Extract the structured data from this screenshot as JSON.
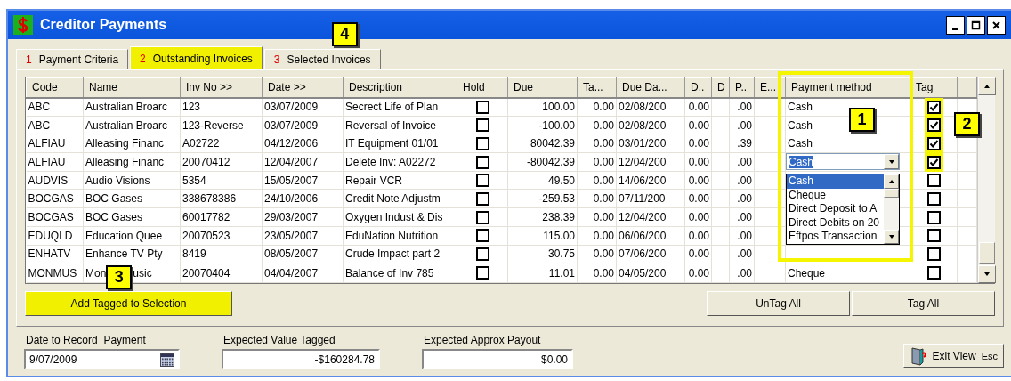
{
  "window": {
    "title": "Creditor Payments"
  },
  "tabs": [
    {
      "number": "1",
      "label": "Payment Criteria",
      "selected": false,
      "highlighted": false
    },
    {
      "number": "2",
      "label": "Outstanding Invoices",
      "selected": true,
      "highlighted": true
    },
    {
      "number": "3",
      "label": "Selected Invoices",
      "selected": false,
      "highlighted": false,
      "callout": "4"
    }
  ],
  "table": {
    "columns": [
      {
        "label": "Code"
      },
      {
        "label": "Name"
      },
      {
        "label": "Inv No >>"
      },
      {
        "label": "Date >>"
      },
      {
        "label": "Description"
      },
      {
        "label": "Hold"
      },
      {
        "label": "Due"
      },
      {
        "label": "Ta..."
      },
      {
        "label": "Due Da..."
      },
      {
        "label": "D.."
      },
      {
        "label": "D"
      },
      {
        "label": "P.."
      },
      {
        "label": "E..."
      },
      {
        "label": "Payment method",
        "highlighted": true,
        "callout": "1"
      },
      {
        "label": "Tag",
        "callout": "2"
      }
    ],
    "rows": [
      {
        "code": "ABC",
        "name": "Australian Broarc",
        "inv_no": "123",
        "date": "03/07/2009",
        "description": "Secrect Life of Plan",
        "hold": false,
        "due": "100.00",
        "ta": "0.00",
        "due_date": "02/08/200",
        "d": "0.00",
        "p": ".00",
        "payment_method": "Cash",
        "tag": true
      },
      {
        "code": "ABC",
        "name": "Australian Broarc",
        "inv_no": "123-Reverse",
        "date": "03/07/2009",
        "description": "Reversal of Invoice",
        "hold": false,
        "due": "-100.00",
        "ta": "0.00",
        "due_date": "02/08/200",
        "d": "0.00",
        "p": ".00",
        "payment_method": "Cash",
        "tag": true
      },
      {
        "code": "ALFIAU",
        "name": "Alleasing Financ",
        "inv_no": "A02722",
        "date": "04/12/2006",
        "description": "IT Equipment 01/01",
        "hold": false,
        "due": "80042.39",
        "ta": "0.00",
        "due_date": "03/01/200",
        "d": "0.00",
        "p": ".39",
        "payment_method": "Cash",
        "tag": true
      },
      {
        "code": "ALFIAU",
        "name": "Alleasing Financ",
        "inv_no": "20070412",
        "date": "12/04/2007",
        "description": "Delete Inv: A02272",
        "hold": false,
        "due": "-80042.39",
        "ta": "0.00",
        "due_date": "12/04/200",
        "d": "0.00",
        "p": ".00",
        "payment_method": "Cash",
        "editing": true,
        "tag": true,
        "dropdown": [
          {
            "label": "Cash",
            "selected": true
          },
          {
            "label": "Cheque",
            "selected": false
          },
          {
            "label": "Direct Deposit to A",
            "selected": false
          },
          {
            "label": "Direct Debits on 20",
            "selected": false
          },
          {
            "label": "Eftpos Transaction",
            "selected": false
          }
        ]
      },
      {
        "code": "AUDVIS",
        "name": "Audio Visions",
        "inv_no": "5354",
        "date": "15/05/2007",
        "description": "Repair VCR",
        "hold": false,
        "due": "49.50",
        "ta": "0.00",
        "due_date": "14/06/200",
        "d": "0.00",
        "p": ".00",
        "tag": false
      },
      {
        "code": "BOCGAS",
        "name": "BOC Gases",
        "inv_no": "338678386",
        "date": "24/10/2006",
        "description": "Credit Note Adjustm",
        "hold": false,
        "due": "-259.53",
        "ta": "0.00",
        "due_date": "07/11/200",
        "d": "0.00",
        "p": ".00",
        "tag": false
      },
      {
        "code": "BOCGAS",
        "name": "BOC Gases",
        "inv_no": "60017782",
        "date": "29/03/2007",
        "description": "Oxygen Indust & Dis",
        "hold": false,
        "due": "238.39",
        "ta": "0.00",
        "due_date": "12/04/200",
        "d": "0.00",
        "p": ".00",
        "tag": false
      },
      {
        "code": "EDUQLD",
        "name": "Education Quee",
        "inv_no": "20070523",
        "date": "23/05/2007",
        "description": "EduNation Nutrition",
        "hold": false,
        "due": "115.00",
        "ta": "0.00",
        "due_date": "06/06/200",
        "d": "0.00",
        "p": ".00",
        "tag": false
      },
      {
        "code": "ENHATV",
        "name": "Enhance TV Pty",
        "inv_no": "8419",
        "date": "08/05/2007",
        "description": "Crude Impact part 2",
        "hold": false,
        "due": "30.75",
        "ta": "0.00",
        "due_date": "07/06/200",
        "d": "0.00",
        "p": ".00",
        "tag": false
      },
      {
        "code": "MONMUS",
        "name": "Mon usic",
        "name_callout": "3",
        "inv_no": "20070404",
        "date": "04/04/2007",
        "description": "Balance of Inv 785",
        "hold": false,
        "due": "11.01",
        "ta": "0.00",
        "due_date": "04/05/200",
        "d": "0.00",
        "p": ".00",
        "payment_method": "Cheque",
        "tag": false
      }
    ]
  },
  "buttons": {
    "add_tagged": {
      "label": "Add Tagged to Selection",
      "highlighted": true
    },
    "untag_all": {
      "label": "UnTag All"
    },
    "tag_all": {
      "label": "Tag All"
    }
  },
  "fields": [
    {
      "kind": "date",
      "label": "Date to Record  Payment",
      "value": "9/07/2009"
    },
    {
      "kind": "amount",
      "label": "Expected Value Tagged",
      "value": "-$160284.78"
    },
    {
      "kind": "amount",
      "label": "Expected Approx Payout",
      "value": "$0.00"
    }
  ],
  "exit_button": {
    "label": "Exit View",
    "shortcut": "Esc"
  }
}
